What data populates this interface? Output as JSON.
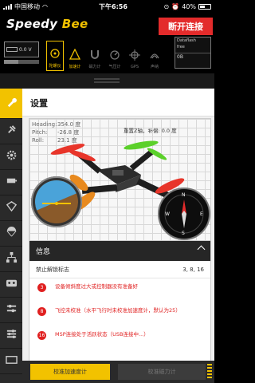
{
  "status_bar": {
    "carrier": "中国移动",
    "time": "下午6:56",
    "battery_percent": "40%",
    "battery_level": 0.4
  },
  "header": {
    "logo_part1": "Speedy ",
    "logo_part2": "Bee",
    "disconnect_label": "断开连接"
  },
  "toolbar": {
    "battery_voltage": "0.0 V",
    "sensors": [
      {
        "label": "陀螺仪",
        "icon": "gyro-icon",
        "active": true
      },
      {
        "label": "加速计",
        "icon": "accelerometer-icon",
        "active": true
      },
      {
        "label": "磁力计",
        "icon": "magnetometer-icon",
        "active": false
      },
      {
        "label": "气压计",
        "icon": "barometer-icon",
        "active": false
      },
      {
        "label": "GPS",
        "icon": "gps-icon",
        "active": false
      },
      {
        "label": "声纳",
        "icon": "sonar-icon",
        "active": false
      }
    ],
    "status_box": {
      "line1": "Dataflash",
      "line2": "free",
      "value": "0B"
    }
  },
  "nav": {
    "items": [
      {
        "name": "setup",
        "icon": "wrench-icon",
        "active": true
      },
      {
        "name": "ports",
        "icon": "plug-icon"
      },
      {
        "name": "config",
        "icon": "gear-icon"
      },
      {
        "name": "failsafe",
        "icon": "battery-alert-icon"
      },
      {
        "name": "pid",
        "icon": "pid-icon"
      },
      {
        "name": "receiver",
        "icon": "parachute-icon"
      },
      {
        "name": "modes",
        "icon": "tree-icon"
      },
      {
        "name": "motors",
        "icon": "remote-icon"
      },
      {
        "name": "osd",
        "icon": "sliders-icon"
      },
      {
        "name": "blackbox",
        "icon": "sliders2-icon"
      },
      {
        "name": "cli",
        "icon": "osd-icon"
      }
    ]
  },
  "main": {
    "title": "设置",
    "readouts": [
      {
        "label": "Heading:",
        "value": "354.0 度"
      },
      {
        "label": "Pitch:",
        "value": "-26.8 度"
      },
      {
        "label": "Roll:",
        "value": "23.1 度"
      }
    ],
    "model_hint": "重置Z轴，补偿: 0.0 度"
  },
  "info": {
    "title": "信息",
    "arming_label": "禁止解锁标志",
    "arming_value": "3, 8, 16",
    "warnings": [
      {
        "number": "3",
        "text": "设备倾斜度过大或控制器没有准备好"
      },
      {
        "number": "8",
        "text": "飞控未校准（水平飞行时未校准加速度计，默认为25）"
      },
      {
        "number": "16",
        "text": "MSP连接处于活跃状态（USB连接中...）"
      }
    ]
  },
  "bottom": {
    "calibrate_acc": "校准加速度计",
    "calibrate_mag": "校准磁力计"
  },
  "colors": {
    "accent": "#f2c200",
    "danger": "#e32b2b",
    "dark": "#1c1c1c"
  }
}
